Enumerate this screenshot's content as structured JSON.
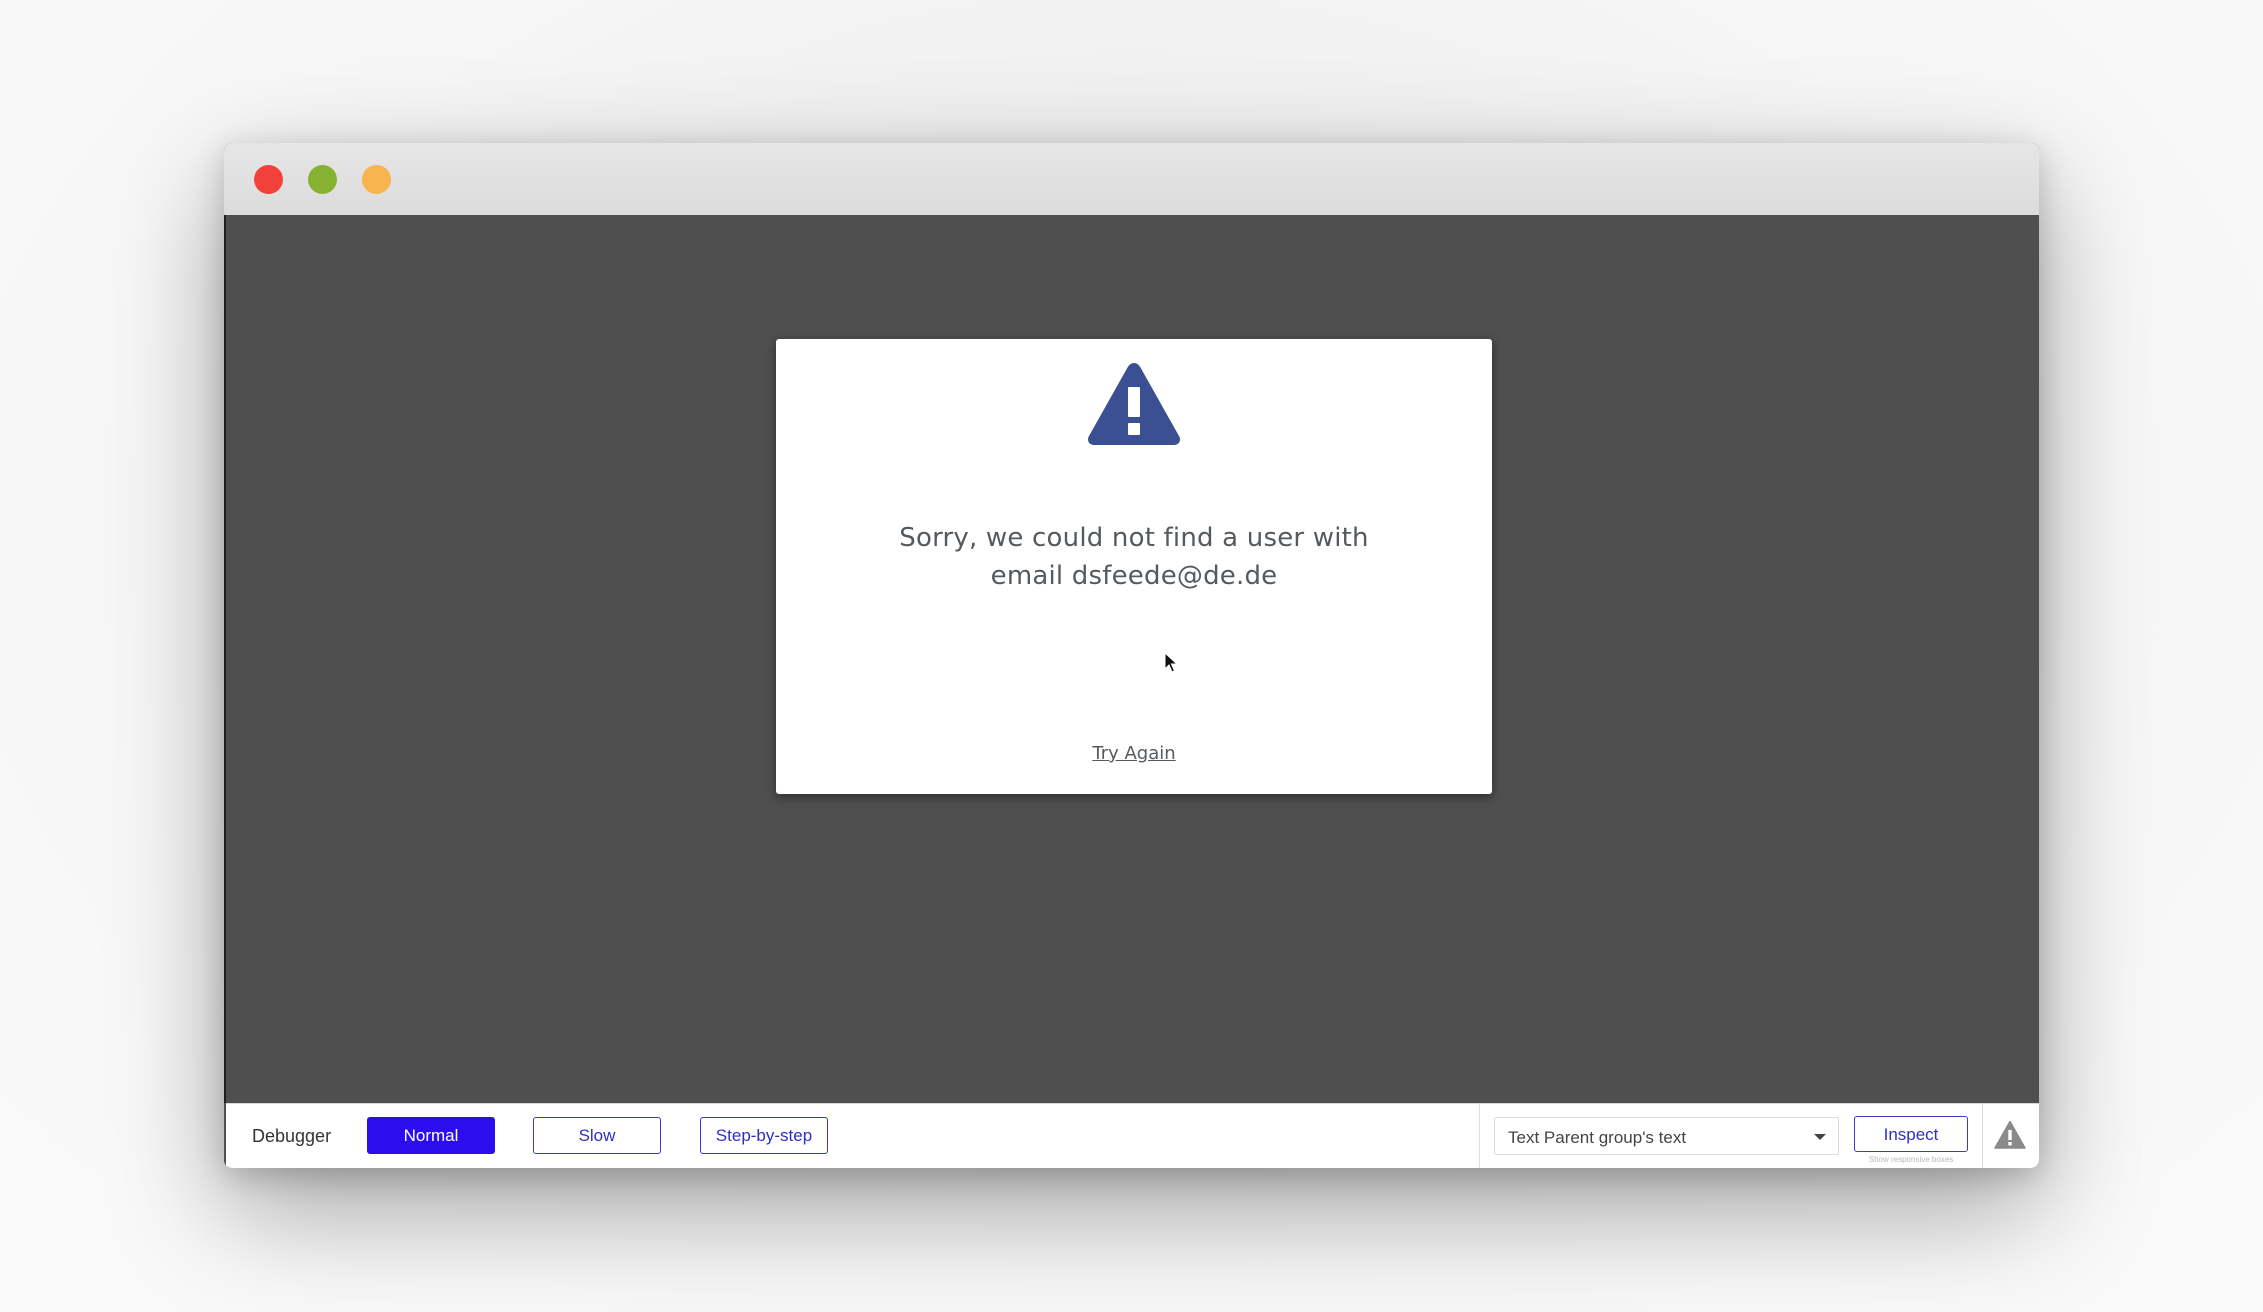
{
  "window": {
    "controls": [
      "close",
      "minimize",
      "maximize"
    ]
  },
  "dialog": {
    "icon": "warning-triangle-icon",
    "icon_color": "#3b4f93",
    "message_line1": "Sorry, we could not find a user with",
    "message_line2": "email dsfeede@de.de",
    "try_again_label": "Try Again"
  },
  "debugger": {
    "label": "Debugger",
    "modes": [
      {
        "label": "Normal",
        "active": true
      },
      {
        "label": "Slow",
        "active": false
      },
      {
        "label": "Step-by-step",
        "active": false
      }
    ],
    "element_select_value": "Text Parent group's text",
    "inspect_label": "Inspect",
    "inspect_sublabel": "Show responsive boxes",
    "issues_icon": "warning-icon",
    "accent_color": "#2c0df0"
  }
}
